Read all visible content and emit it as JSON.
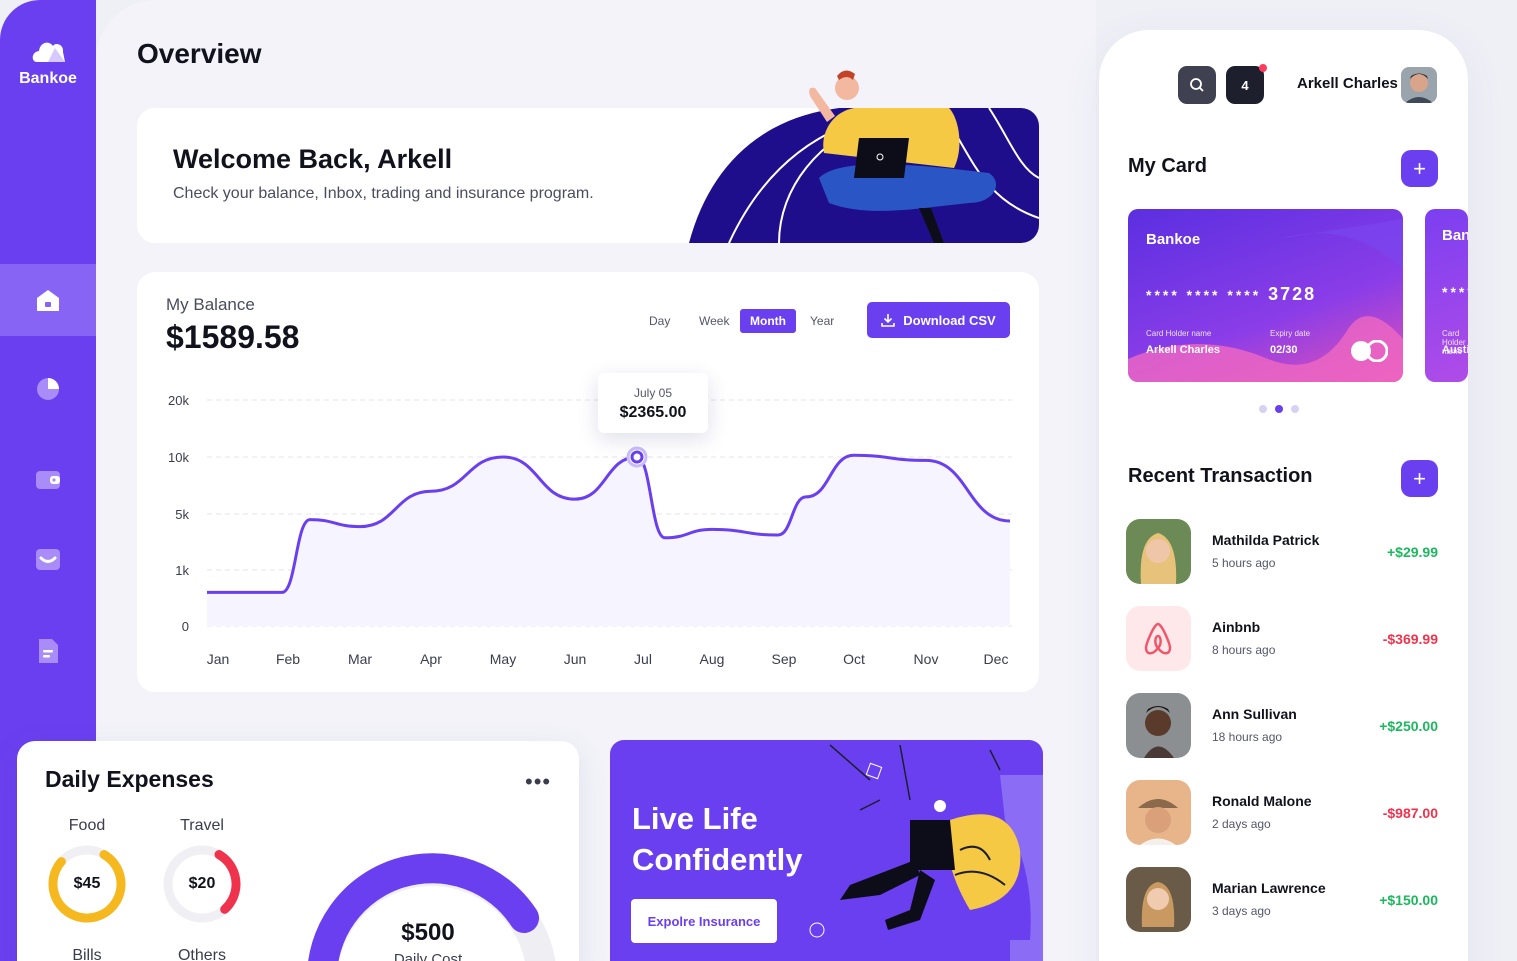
{
  "brand": {
    "name": "Bankoe"
  },
  "nav": [
    {
      "name": "home-icon",
      "active": true
    },
    {
      "name": "pie-chart-icon",
      "active": false
    },
    {
      "name": "wallet-icon",
      "active": false
    },
    {
      "name": "inbox-icon",
      "active": false
    },
    {
      "name": "document-icon",
      "active": false
    },
    {
      "name": "settings-icon",
      "active": false
    }
  ],
  "page": {
    "title": "Overview"
  },
  "welcome": {
    "title": "Welcome Back, Arkell",
    "subtitle": "Check your balance, Inbox, trading and insurance program."
  },
  "balance": {
    "label": "My Balance",
    "value": "$1589.58",
    "periods": [
      "Day",
      "Week",
      "Month",
      "Year"
    ],
    "active_period": "Month",
    "download_label": "Download CSV",
    "tooltip_date": "July 05",
    "tooltip_value": "$2365.00"
  },
  "chart_data": {
    "type": "line",
    "categories": [
      "Jan",
      "Feb",
      "Mar",
      "Apr",
      "May",
      "Jun",
      "Jul",
      "Aug",
      "Sep",
      "Oct",
      "Nov",
      "Dec"
    ],
    "y_ticks": [
      "20k",
      "10k",
      "5k",
      "1k",
      "0"
    ],
    "series": [
      {
        "values": [
          {
            "x": "Jan",
            "y": 0.6
          },
          {
            "x": "Feb",
            "y": 0.6
          },
          {
            "x": "Feb",
            "y": 4.6
          },
          {
            "x": "Mar",
            "y": 4.1
          },
          {
            "x": "Apr",
            "y": 7.0
          },
          {
            "x": "May",
            "y": 10.0
          },
          {
            "x": "Jun",
            "y": 6.3
          },
          {
            "x": "Jul",
            "y": 10.0
          },
          {
            "x": "Jul",
            "y": 3.3
          },
          {
            "x": "Aug",
            "y": 3.9
          },
          {
            "x": "Sep",
            "y": 3.5
          },
          {
            "x": "Sep",
            "y": 6.5
          },
          {
            "x": "Oct",
            "y": 10.3
          },
          {
            "x": "Nov",
            "y": 9.7
          },
          {
            "x": "Dec",
            "y": 4.5
          }
        ],
        "color": "#6a3ff0"
      }
    ],
    "grid": true,
    "highlight": {
      "x": "Jul",
      "label_date": "July 05",
      "label_value": "$2365.00"
    }
  },
  "daily": {
    "title": "Daily Expenses",
    "items": [
      {
        "label": "Food",
        "value": "$45",
        "color": "#f6b81f",
        "fraction": 0.78
      },
      {
        "label": "Travel",
        "value": "$20",
        "color": "#f0334d",
        "fraction": 0.3
      },
      {
        "label": "Bills"
      },
      {
        "label": "Others"
      }
    ],
    "big_value": "$500",
    "big_label": "Daily Cost"
  },
  "insurance": {
    "title": "Live Life Confidently",
    "button": "Expolre Insurance"
  },
  "user": {
    "name": "Arkell Charles",
    "notifications": "4"
  },
  "my_card": {
    "title": "My Card",
    "cards": [
      {
        "brand": "Bankoe",
        "masked": "**** **** ****",
        "last4": "3728",
        "holder_label": "Card Holder name",
        "holder": "Arkell Charles",
        "expiry_label": "Expiry date",
        "expiry": "02/30"
      },
      {
        "brand": "Bankoe",
        "masked": "**** **",
        "holder_label": "Card Holder name",
        "holder": "Austin Hammo"
      }
    ]
  },
  "transactions": {
    "title": "Recent Transaction",
    "items": [
      {
        "name": "Mathilda Patrick",
        "time": "5 hours ago",
        "amount": "+$29.99",
        "type": "pos"
      },
      {
        "name": "Ainbnb",
        "time": "8 hours ago",
        "amount": "-$369.99",
        "type": "neg"
      },
      {
        "name": "Ann Sullivan",
        "time": "18 hours ago",
        "amount": "+$250.00",
        "type": "pos"
      },
      {
        "name": "Ronald Malone",
        "time": "2 days ago",
        "amount": "-$987.00",
        "type": "neg"
      },
      {
        "name": "Marian Lawrence",
        "time": "3 days ago",
        "amount": "+$150.00",
        "type": "pos"
      }
    ]
  }
}
